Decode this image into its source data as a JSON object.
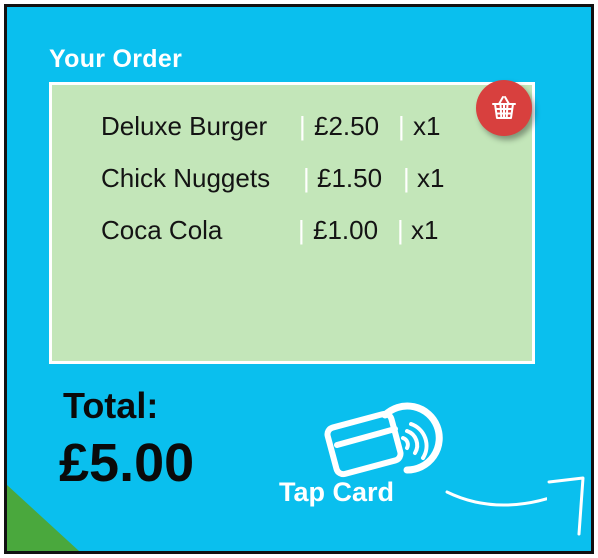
{
  "order": {
    "heading": "Your Order",
    "items": [
      {
        "name": "Deluxe Burger",
        "price": "£2.50",
        "qty": "x1"
      },
      {
        "name": "Chick Nuggets",
        "price": "£1.50",
        "qty": "x1"
      },
      {
        "name": "Coca Cola",
        "price": "£1.00",
        "qty": "x1"
      }
    ],
    "separator": "|"
  },
  "basket": {
    "icon": "basket-icon"
  },
  "total": {
    "label": "Total:",
    "value": "£5.00"
  },
  "payment": {
    "tap_label": "Tap Card",
    "icon": "contactless-card-icon"
  },
  "colors": {
    "background": "#0abfee",
    "panel": "#c3e6b9",
    "basket": "#d8403e",
    "corner": "#4aa83d"
  }
}
